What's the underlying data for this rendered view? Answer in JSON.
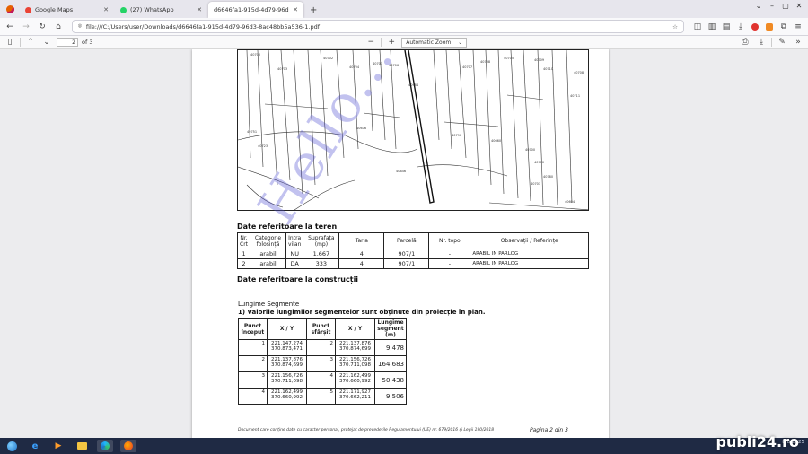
{
  "tabs": [
    {
      "label": "Google Maps",
      "color": "#ea4335",
      "active": false
    },
    {
      "label": "(27) WhatsApp",
      "color": "#25d366",
      "active": false
    },
    {
      "label": "d6646fa1-915d-4d79-96d3-8ac48bb5a",
      "color": "#7a7a7a",
      "active": true
    }
  ],
  "address": {
    "url": "file:///C:/Users/user/Downloads/d6646fa1-915d-4d79-96d3-8ac48bb5a536-1.pdf"
  },
  "pdf_toolbar": {
    "page_value": "2",
    "page_total": "of 3",
    "zoom": "Automatic Zoom"
  },
  "map": {
    "parcel_labels": [
      "40700",
      "40703",
      "40702",
      "40701",
      "40704",
      "40706",
      "40707",
      "40738",
      "40705",
      "40709",
      "40710",
      "40708",
      "40711",
      "40751",
      "40723",
      "40676",
      "40790",
      "40660",
      "40700",
      "40770",
      "40780",
      "40701",
      "40646",
      "40604"
    ],
    "main_label": "40984"
  },
  "teren": {
    "title": "Date referitoare la teren",
    "headers": [
      "Nr. Crt",
      "Categorie folosință",
      "Intra vilan",
      "Suprafața (mp)",
      "Tarla",
      "Parcelă",
      "Nr. topo",
      "Observații / Referințe"
    ],
    "rows": [
      [
        "1",
        "arabil",
        "NU",
        "1.667",
        "4",
        "907/1",
        "-",
        "ARABIL IN PARLOG"
      ],
      [
        "2",
        "arabil",
        "DA",
        "333",
        "4",
        "907/1",
        "-",
        "ARABIL IN PARLOG"
      ]
    ]
  },
  "constructii": {
    "title": "Date referitoare la construcții"
  },
  "lungime": {
    "title": "Lungime Segmente",
    "subtitle": "1) Valorile lungimilor segmentelor sunt obținute din proiecție în plan.",
    "headers": [
      "Punct început",
      "X / Y",
      "Punct sfârșit",
      "X / Y",
      "Lungime segment (m)"
    ],
    "rows": [
      [
        "1",
        "221.147,274",
        "370.873,471",
        "2",
        "221.137,876",
        "370.874,699",
        "9,478"
      ],
      [
        "2",
        "221.137,876",
        "370.874,699",
        "3",
        "221.156,726",
        "370.711,098",
        "164,683"
      ],
      [
        "3",
        "221.156,726",
        "370.711,098",
        "4",
        "221.162,499",
        "370.660,992",
        "50,438"
      ],
      [
        "4",
        "221.162,499",
        "370.660,992",
        "5",
        "221.171,927",
        "370.662,211",
        "9,506"
      ]
    ]
  },
  "footer": {
    "note": "Document care conține date cu caracter personal, protejat de prevederile Regulamentului (UE) nr. 679/2016 și Legii 190/2018",
    "page": "Pagina 2 din 3"
  },
  "watermark": "Hello...!!",
  "taskbar": {
    "date": "8/8/2025",
    "brand": "publi24.ro"
  }
}
